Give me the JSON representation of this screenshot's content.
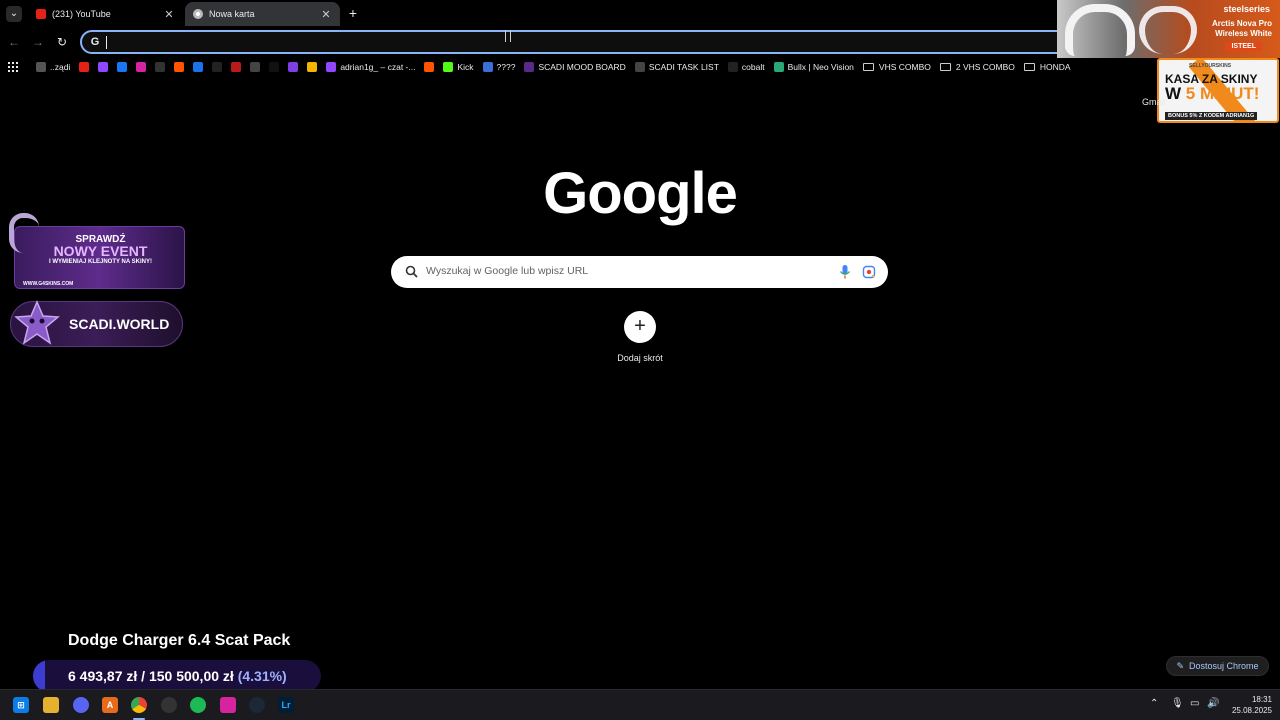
{
  "tabs": [
    {
      "title": "(231) YouTube",
      "favicon": "youtube-icon"
    },
    {
      "title": "Nowa karta",
      "favicon": "chrome-icon",
      "active": true
    }
  ],
  "toolbar": {
    "omnibox_value": ""
  },
  "bookmarks": [
    {
      "label": "..ządi",
      "icon_color": "#555"
    },
    {
      "label": "",
      "icon_color": "#e62117"
    },
    {
      "label": "",
      "icon_color": "#9146ff"
    },
    {
      "label": "",
      "icon_color": "#1877f2"
    },
    {
      "label": "",
      "icon_color": "#d6249f"
    },
    {
      "label": "",
      "icon_color": "#333"
    },
    {
      "label": "",
      "icon_color": "#ff5500"
    },
    {
      "label": "",
      "icon_color": "#1a73e8"
    },
    {
      "label": "",
      "icon_color": "#222"
    },
    {
      "label": "",
      "icon_color": "#b71c1c"
    },
    {
      "label": "",
      "icon_color": "#444"
    },
    {
      "label": "",
      "icon_color": "#111"
    },
    {
      "label": "",
      "icon_color": "#7b3fe4"
    },
    {
      "label": "",
      "icon_color": "#f5b400"
    },
    {
      "label": "adrian1g_ – czat -...",
      "icon_color": "#9146ff"
    },
    {
      "label": "",
      "icon_color": "#ff5500"
    },
    {
      "label": "Kick",
      "icon_color": "#53fc18"
    },
    {
      "label": "????",
      "icon_color": "#3b6fd8"
    },
    {
      "label": "SCADI MOOD BOARD",
      "icon_color": "#5a2a8a"
    },
    {
      "label": "SCADI TASK LIST",
      "icon_color": "#444"
    },
    {
      "label": "cobalt",
      "icon_color": "#222"
    },
    {
      "label": "Bullx | Neo Vision",
      "icon_color": "#2aa876"
    }
  ],
  "folders": [
    "VHS COMBO",
    "2 VHS COMBO",
    "HONDA"
  ],
  "ads": {
    "steelseries": {
      "brand": "steelseries",
      "product": "Arctis Nova Pro Wireless White",
      "code": "ISTEEL"
    },
    "kasa": {
      "line1": "KASA ZA SKINY",
      "line2a": "W ",
      "line2b": "5 MINUT!",
      "line3": "BONUS 5% Z KODEM ADRIAN1G",
      "small": "SELLYOURSKINS"
    },
    "event": {
      "line1": "SPRAWDŹ",
      "line2": "NOWY EVENT",
      "line3": "I WYMIENIAJ KLEJNOTY NA SKINY!",
      "site": "WWW.G4SKINS.COM"
    },
    "scadi": {
      "label": "SCADI.WORLD"
    }
  },
  "gmail_label": "Gmail",
  "google": {
    "logo": "Google",
    "search_placeholder": "Wyszukaj w Google lub wpisz URL",
    "shortcut_label": "Dodaj skrót"
  },
  "overlay": {
    "title": "Dodge Charger 6.4 Scat Pack",
    "raised": "6 493,87 zł",
    "separator": "/",
    "goal": "150 500,00 zł",
    "percent_label": "(4.31%)",
    "progress_fraction": 0.0431
  },
  "customize_label": "Dostosuj Chrome",
  "clock": {
    "time": "18:31",
    "date": "25.08.2025"
  }
}
